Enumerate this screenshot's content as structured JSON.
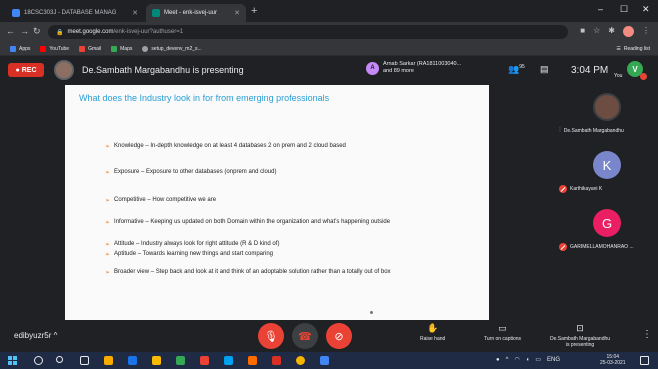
{
  "browser": {
    "tabs": [
      {
        "title": "18CSC303J - DATABASE MANAG",
        "active": false
      },
      {
        "title": "Meet - enk-isvej-uur",
        "active": true
      }
    ],
    "new_tab": "+",
    "url_host": "meet.google.com",
    "url_path": "/enk-isvej-uur?authuser=1",
    "bookmarks": [
      {
        "label": "Apps",
        "color": "#4285f4"
      },
      {
        "label": "YouTube",
        "color": "#ff0000"
      },
      {
        "label": "Gmail",
        "color": "#ea4335"
      },
      {
        "label": "Maps",
        "color": "#34a853"
      },
      {
        "label": "setup_devenv_m2_s...",
        "color": "#9aa0a6"
      }
    ],
    "reading_list": "Reading list",
    "window_controls": {
      "minimize": "–",
      "maximize": "☐",
      "close": "✕"
    }
  },
  "meet": {
    "rec_label": "REC",
    "presenting_text": "De.Sambath Margabandhu is presenting",
    "others": {
      "initial": "A",
      "line1": "Arnab Sarkar (RA1811003040...",
      "line2": "and 89 more"
    },
    "people_count": "95",
    "clock": "3:04 PM",
    "you_label": "You",
    "self_initial": "V",
    "participants": [
      {
        "name": "De.Sambath Margabandhu",
        "initial": "",
        "type": "photo",
        "muted": false
      },
      {
        "name": "Karthikayani K",
        "initial": "K",
        "type": "k",
        "muted": true
      },
      {
        "name": "GARIMELLAMOHANRAO ...",
        "initial": "G",
        "type": "g",
        "muted": true
      }
    ]
  },
  "slide": {
    "title": "What does the Industry look  in for from emerging professionals",
    "bullets": [
      "Knowledge – In-depth knowledge on at least 4 databases  2 on prem and 2 cloud based",
      "Exposure – Exposure to other databases (onprem and cloud)",
      "Competitive – How competitive we are",
      "Informative – Keeping us updated on both Domain within the organization and what’s happening outside",
      "Attitude – Industry always look for right attitude (R & D kind of)",
      "Aptitude – Towards learning new things and start comparing",
      "Broader view – Step back and look at it  and think of an adoptable solution rather than a totally out of box"
    ]
  },
  "controls": {
    "meeting_code": "edibyuzr5r",
    "raise_hand": "Raise hand",
    "captions": "Turn on captions",
    "presenting_line1": "De.Sambath Margabandhu",
    "presenting_line2": "is presenting",
    "more": "⋮"
  },
  "taskbar": {
    "tray": "ENG",
    "time": "15:04",
    "date": "25-03-2021"
  }
}
